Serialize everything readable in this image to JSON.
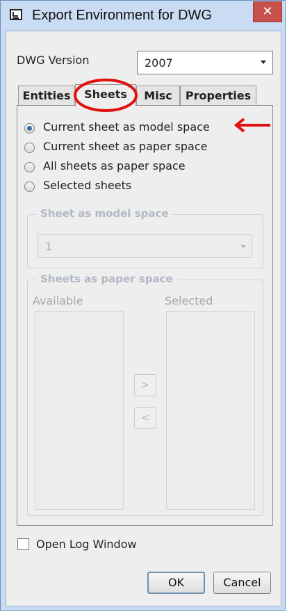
{
  "window": {
    "title": "Export Environment for DWG",
    "close_glyph": "✕"
  },
  "dwg_version": {
    "label": "DWG Version",
    "value": "2007"
  },
  "tabs": [
    {
      "label": "Entities",
      "active": false
    },
    {
      "label": "Sheets",
      "active": true
    },
    {
      "label": "Misc",
      "active": false
    },
    {
      "label": "Properties",
      "active": false
    }
  ],
  "sheets": {
    "options": [
      {
        "label": "Current sheet as model space",
        "checked": true
      },
      {
        "label": "Current sheet as paper space",
        "checked": false
      },
      {
        "label": "All sheets as paper space",
        "checked": false
      },
      {
        "label": "Selected sheets",
        "checked": false
      }
    ],
    "model_space_group": {
      "title": "Sheet as model space",
      "value": "1"
    },
    "paper_space_group": {
      "title": "Sheets as paper space",
      "available_label": "Available",
      "selected_label": "Selected",
      "add_glyph": ">",
      "remove_glyph": "<"
    }
  },
  "open_log": {
    "label": "Open Log Window",
    "checked": false
  },
  "buttons": {
    "ok": "OK",
    "cancel": "Cancel"
  },
  "colors": {
    "annotation_red": "#e01010",
    "title_bar": "#c9dcf3",
    "close_button": "#c7504d",
    "radio_selected": "#3c6e9f"
  },
  "icons": {
    "app": "dwg-export-icon",
    "close": "close-icon",
    "dropdown": "chevron-down-icon",
    "annotation": "red-arrow-icon"
  }
}
